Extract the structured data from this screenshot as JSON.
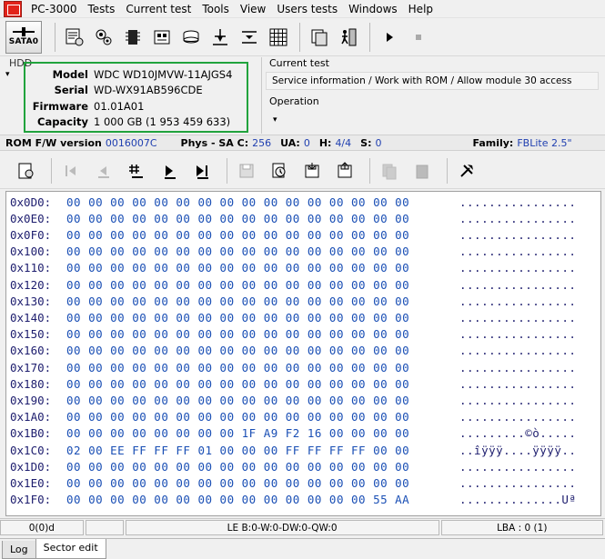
{
  "menu": {
    "items": [
      "PC-3000",
      "Tests",
      "Current test",
      "Tools",
      "View",
      "Users tests",
      "Windows",
      "Help"
    ]
  },
  "toolbar": {
    "sata_label": "SATA0",
    "icons": [
      "drive-info-icon",
      "gears-icon",
      "chip-icon",
      "memory-board-icon",
      "disk-icon",
      "heads-icon",
      "tracks-icon",
      "grid-table-icon",
      "pages-icon",
      "exit-door-icon",
      "play-icon",
      "stop-icon"
    ]
  },
  "hdd": {
    "caption": "HDD",
    "model_label": "Model",
    "model": "WDC WD10JMVW-11AJGS4",
    "serial_label": "Serial",
    "serial": "WD-WX91AB596CDE",
    "firmware_label": "Firmware",
    "firmware": "01.01A01",
    "capacity_label": "Capacity",
    "capacity": "1 000 GB (1 953 459 633)"
  },
  "current_test": {
    "caption": "Current test",
    "text": "Service information / Work with ROM / Allow module 30 access",
    "operation_caption": "Operation"
  },
  "infobar": {
    "rom_label": "ROM F/W version",
    "rom_value": "0016007C",
    "phys_label": "Phys - SA C:",
    "phys_value": "256",
    "ua_label": "UA:",
    "ua_value": "0",
    "h_label": "H:",
    "h_value": "4/4",
    "s_label": "S:",
    "s_value": "0",
    "family_label": "Family:",
    "family_value": "FBLite 2.5\""
  },
  "hex": {
    "rows": [
      {
        "addr": "0x0D0:",
        "bytes": "00 00 00 00 00 00 00 00 00 00 00 00 00 00 00 00",
        "ascii": "................"
      },
      {
        "addr": "0x0E0:",
        "bytes": "00 00 00 00 00 00 00 00 00 00 00 00 00 00 00 00",
        "ascii": "................"
      },
      {
        "addr": "0x0F0:",
        "bytes": "00 00 00 00 00 00 00 00 00 00 00 00 00 00 00 00",
        "ascii": "................"
      },
      {
        "addr": "0x100:",
        "bytes": "00 00 00 00 00 00 00 00 00 00 00 00 00 00 00 00",
        "ascii": "................"
      },
      {
        "addr": "0x110:",
        "bytes": "00 00 00 00 00 00 00 00 00 00 00 00 00 00 00 00",
        "ascii": "................"
      },
      {
        "addr": "0x120:",
        "bytes": "00 00 00 00 00 00 00 00 00 00 00 00 00 00 00 00",
        "ascii": "................"
      },
      {
        "addr": "0x130:",
        "bytes": "00 00 00 00 00 00 00 00 00 00 00 00 00 00 00 00",
        "ascii": "................"
      },
      {
        "addr": "0x140:",
        "bytes": "00 00 00 00 00 00 00 00 00 00 00 00 00 00 00 00",
        "ascii": "................"
      },
      {
        "addr": "0x150:",
        "bytes": "00 00 00 00 00 00 00 00 00 00 00 00 00 00 00 00",
        "ascii": "................"
      },
      {
        "addr": "0x160:",
        "bytes": "00 00 00 00 00 00 00 00 00 00 00 00 00 00 00 00",
        "ascii": "................"
      },
      {
        "addr": "0x170:",
        "bytes": "00 00 00 00 00 00 00 00 00 00 00 00 00 00 00 00",
        "ascii": "................"
      },
      {
        "addr": "0x180:",
        "bytes": "00 00 00 00 00 00 00 00 00 00 00 00 00 00 00 00",
        "ascii": "................"
      },
      {
        "addr": "0x190:",
        "bytes": "00 00 00 00 00 00 00 00 00 00 00 00 00 00 00 00",
        "ascii": "................"
      },
      {
        "addr": "0x1A0:",
        "bytes": "00 00 00 00 00 00 00 00 00 00 00 00 00 00 00 00",
        "ascii": "................"
      },
      {
        "addr": "0x1B0:",
        "bytes": "00 00 00 00 00 00 00 00 1F A9 F2 16 00 00 00 00",
        "ascii": ".........©ò....."
      },
      {
        "addr": "0x1C0:",
        "bytes": "02 00 EE FF FF FF 01 00 00 00 FF FF FF FF 00 00",
        "ascii": "..îÿÿÿ....ÿÿÿÿ.."
      },
      {
        "addr": "0x1D0:",
        "bytes": "00 00 00 00 00 00 00 00 00 00 00 00 00 00 00 00",
        "ascii": "................"
      },
      {
        "addr": "0x1E0:",
        "bytes": "00 00 00 00 00 00 00 00 00 00 00 00 00 00 00 00",
        "ascii": "................"
      },
      {
        "addr": "0x1F0:",
        "bytes": "00 00 00 00 00 00 00 00 00 00 00 00 00 00 55 AA",
        "ascii": "..............Uª"
      }
    ]
  },
  "status": {
    "position": "0(0)d",
    "blank": "",
    "le": "LE B:0-W:0-DW:0-QW:0",
    "lba": "LBA : 0 (1)"
  },
  "tabs": [
    "Log",
    "Sector edit"
  ],
  "colors": {
    "highlight_box": "#21a33d",
    "value_blue": "#1f3fb0",
    "hex_blue": "#1a4fb5"
  }
}
